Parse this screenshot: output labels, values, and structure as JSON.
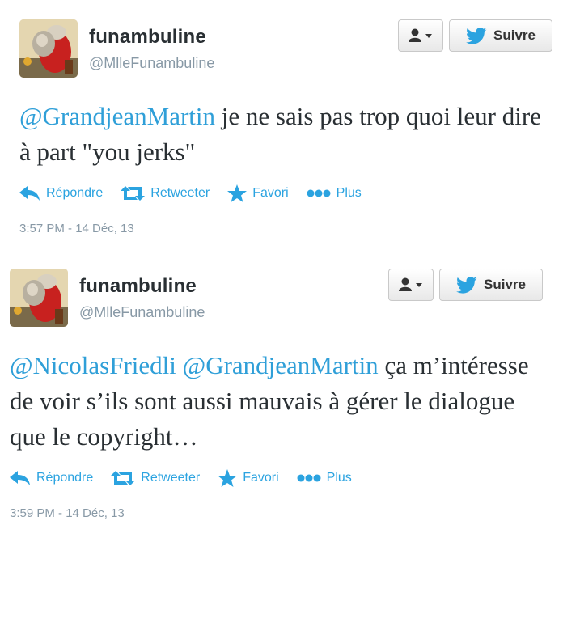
{
  "tweets": [
    {
      "fullname": "funambuline",
      "screenname": "@MlleFunambuline",
      "follow_label": "Suivre",
      "text_parts": [
        {
          "text": "@GrandjeanMartin",
          "mention": true
        },
        {
          "text": " je ne sais pas trop quoi leur dire à part \"you jerks\"",
          "mention": false
        }
      ],
      "actions": {
        "reply": "Répondre",
        "retweet": "Retweeter",
        "favorite": "Favori",
        "more": "Plus"
      },
      "timestamp": "3:57 PM - 14 Déc, 13"
    },
    {
      "fullname": "funambuline",
      "screenname": "@MlleFunambuline",
      "follow_label": "Suivre",
      "text_parts": [
        {
          "text": "@NicolasFriedli",
          "mention": true
        },
        {
          "text": " ",
          "mention": false
        },
        {
          "text": "@GrandjeanMartin",
          "mention": true
        },
        {
          "text": " ça m’intéresse de voir s’ils sont aussi mauvais à gérer le dialogue que le copyright…",
          "mention": false
        }
      ],
      "actions": {
        "reply": "Répondre",
        "retweet": "Retweeter",
        "favorite": "Favori",
        "more": "Plus"
      },
      "timestamp": "3:59 PM - 14 Déc, 13"
    }
  ],
  "icons": {
    "user_dropdown": "user-icon",
    "follow": "twitter-bird-icon",
    "reply": "reply-arrow-icon",
    "retweet": "retweet-icon",
    "favorite": "star-icon",
    "more": "dots-icon"
  },
  "colors": {
    "link": "#2ba3e0",
    "mention": "#2f9fd8",
    "muted": "#8899a6",
    "text": "#292f33",
    "bird": "#2ba3e0"
  }
}
